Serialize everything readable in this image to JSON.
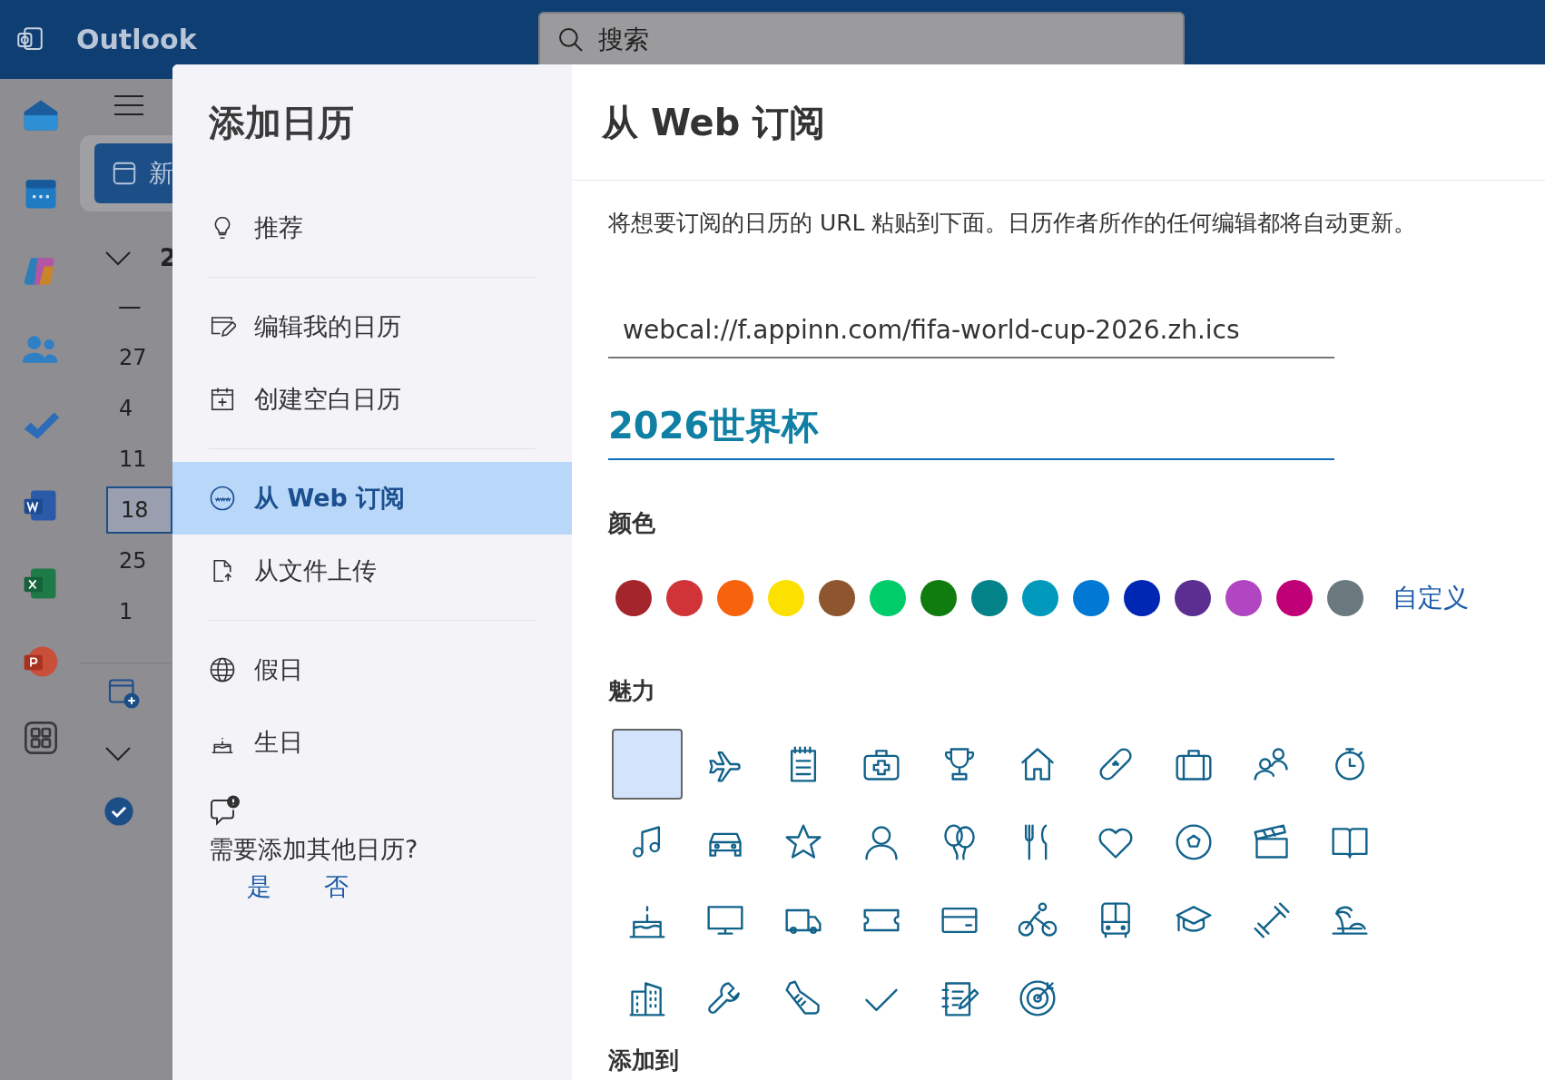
{
  "app_bar": {
    "app_name": "Outlook",
    "search": {
      "placeholder": "搜索"
    }
  },
  "background": {
    "new_button": "新",
    "month_label": "2",
    "weekday": "一",
    "days": [
      {
        "label": "27",
        "selected": false
      },
      {
        "label": "4",
        "selected": false
      },
      {
        "label": "11",
        "selected": false
      },
      {
        "label": "18",
        "selected": true
      },
      {
        "label": "25",
        "selected": false
      },
      {
        "label": "1",
        "selected": false
      }
    ],
    "calendar_item": {
      "checked": true
    }
  },
  "dialog": {
    "title": "添加日历",
    "nav_groups": [
      [
        {
          "label": "推荐",
          "selected": false
        }
      ],
      [
        {
          "label": "编辑我的日历",
          "selected": false
        },
        {
          "label": "创建空白日历",
          "selected": false
        }
      ],
      [
        {
          "label": "从 Web 订阅",
          "selected": true
        },
        {
          "label": "从文件上传",
          "selected": false
        }
      ],
      [
        {
          "label": "假日",
          "selected": false
        },
        {
          "label": "生日",
          "selected": false
        }
      ]
    ],
    "feedback": {
      "question": "需要添加其他日历?",
      "yes": "是",
      "no": "否"
    },
    "form": {
      "heading": "从 Web 订阅",
      "description": "将想要订阅的日历的 URL 粘贴到下面。日历作者所作的任何编辑都将自动更新。",
      "url": "webcal://f.appinn.com/fifa-world-cup-2026.zh.ics",
      "name": "2026世界杯",
      "color_label": "颜色",
      "colors": [
        {
          "color": "#a4262c"
        },
        {
          "color": "#d13438"
        },
        {
          "color": "#f7630c"
        },
        {
          "color": "#fce100"
        },
        {
          "color": "#8e562e"
        },
        {
          "color": "#00cc6a"
        },
        {
          "color": "#107c10"
        },
        {
          "color": "#038387"
        },
        {
          "color": "#0099bc"
        },
        {
          "color": "#0078d4"
        },
        {
          "color": "#0027b4"
        },
        {
          "color": "#5c2e91"
        },
        {
          "color": "#b146c2"
        },
        {
          "color": "#bf0077"
        },
        {
          "color": "#69797e"
        }
      ],
      "custom_link": "自定义",
      "charm_label": "魅力",
      "charms": [
        {
          "selected": true
        },
        {
          "selected": false
        },
        {
          "selected": false
        },
        {
          "selected": false
        },
        {
          "selected": false
        },
        {
          "selected": false
        },
        {
          "selected": false
        },
        {
          "selected": false
        },
        {
          "selected": false
        },
        {
          "selected": false
        },
        {
          "selected": false
        },
        {
          "selected": false
        },
        {
          "selected": false
        },
        {
          "selected": false
        },
        {
          "selected": false
        },
        {
          "selected": false
        },
        {
          "selected": false
        },
        {
          "selected": false
        },
        {
          "selected": false
        },
        {
          "selected": false
        },
        {
          "selected": false
        },
        {
          "selected": false
        },
        {
          "selected": false
        },
        {
          "selected": false
        },
        {
          "selected": false
        },
        {
          "selected": false
        },
        {
          "selected": false
        },
        {
          "selected": false
        },
        {
          "selected": false
        },
        {
          "selected": false
        },
        {
          "selected": false
        },
        {
          "selected": false
        },
        {
          "selected": false
        },
        {
          "selected": false
        },
        {
          "selected": false
        },
        {
          "selected": false
        }
      ],
      "add_to_label": "添加到"
    }
  }
}
